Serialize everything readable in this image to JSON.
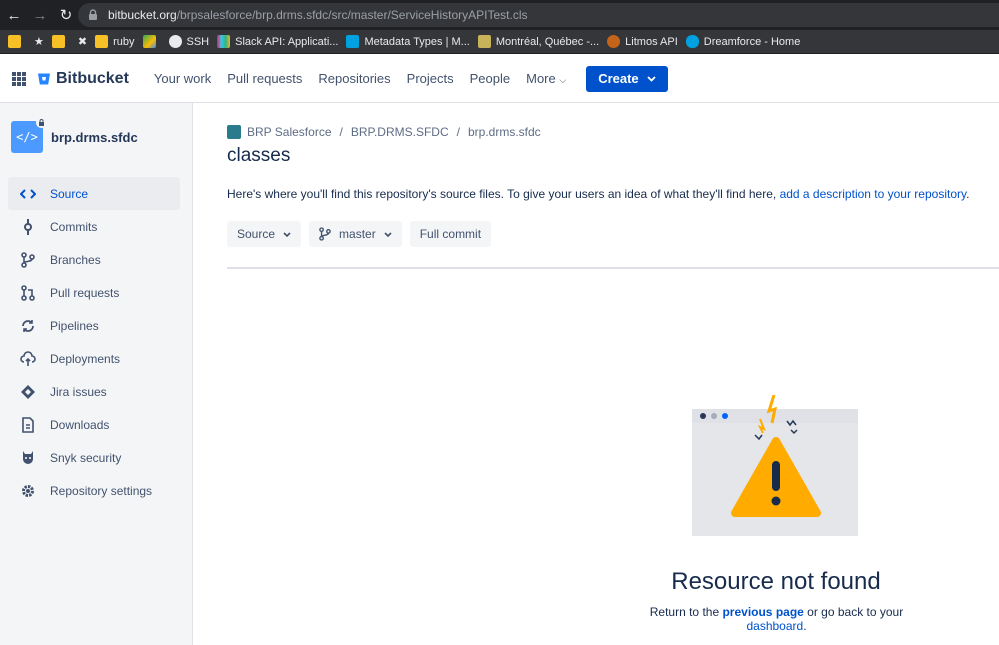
{
  "browser": {
    "url_host": "bitbucket.org",
    "url_path": "/brpsalesforce/brp.drms.sfdc/src/master/ServiceHistoryAPITest.cls",
    "bookmarks": [
      {
        "label": "",
        "color": "#f6c026"
      },
      {
        "label": "★",
        "color": "#35363a"
      },
      {
        "label": "",
        "color": "#f6c026"
      },
      {
        "label": "✖",
        "color": "#35363a"
      },
      {
        "label": "ruby",
        "color": "#f6c026"
      },
      {
        "label": "",
        "color": "#34a853"
      },
      {
        "label": "SSH",
        "color": "#e8eaed"
      },
      {
        "label": "Slack API: Applicati...",
        "color": "#e01e5a"
      },
      {
        "label": "Metadata Types | M...",
        "color": "#00a1e0"
      },
      {
        "label": "Montréal, Québec -...",
        "color": "#c8b35b"
      },
      {
        "label": "Litmos API",
        "color": "#c4631a"
      },
      {
        "label": "Dreamforce - Home",
        "color": "#00a1e0"
      }
    ]
  },
  "header": {
    "logo": "Bitbucket",
    "nav": [
      "Your work",
      "Pull requests",
      "Repositories",
      "Projects",
      "People",
      "More"
    ],
    "create_label": "Create"
  },
  "sidebar": {
    "repo_name": "brp.drms.sfdc",
    "items": [
      {
        "label": "Source",
        "icon": "code-icon",
        "active": true
      },
      {
        "label": "Commits",
        "icon": "commit-icon"
      },
      {
        "label": "Branches",
        "icon": "branch-icon"
      },
      {
        "label": "Pull requests",
        "icon": "pull-request-icon"
      },
      {
        "label": "Pipelines",
        "icon": "pipelines-icon"
      },
      {
        "label": "Deployments",
        "icon": "deployments-icon"
      },
      {
        "label": "Jira issues",
        "icon": "jira-icon"
      },
      {
        "label": "Downloads",
        "icon": "downloads-icon"
      },
      {
        "label": "Snyk security",
        "icon": "snyk-icon"
      },
      {
        "label": "Repository settings",
        "icon": "gear-icon"
      }
    ]
  },
  "main": {
    "breadcrumb": [
      "BRP Salesforce",
      "BRP.DRMS.SFDC",
      "brp.drms.sfdc"
    ],
    "title": "classes",
    "description": "Here's where you'll find this repository's source files. To give your users an idea of what they'll find here,",
    "description_link": "add a description to your repository",
    "description_end": ".",
    "toolbar": {
      "source_label": "Source",
      "branch_label": "master",
      "full_commit_label": "Full commit"
    },
    "not_found": {
      "title": "Resource not found",
      "text_before": "Return to the",
      "previous_link": "previous page",
      "text_middle": "or go back to your",
      "dashboard_link": "dashboard",
      "text_end": "."
    }
  },
  "colors": {
    "brand": "#0052cc",
    "warning": "#ffab00"
  }
}
